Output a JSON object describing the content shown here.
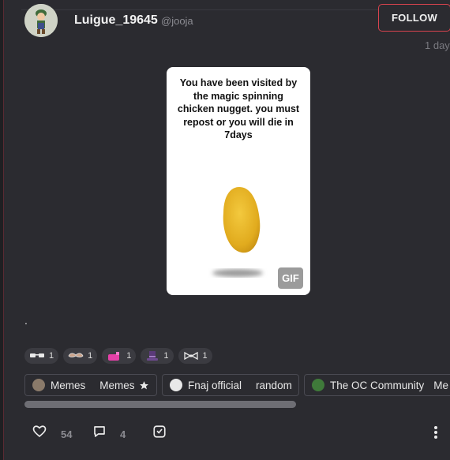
{
  "post": {
    "username": "Luigue_19645",
    "handle": "@jooja",
    "follow_label": "FOLLOW",
    "time": "1 day",
    "body": "."
  },
  "gif": {
    "caption": "You have been visited by the magic spinning chicken nugget. you must repost or you will die in 7days",
    "badge": "GIF"
  },
  "reactions": [
    {
      "icon": "glasses-icon",
      "count": "1"
    },
    {
      "icon": "mustache-icon",
      "count": "1"
    },
    {
      "icon": "pink-potion-icon",
      "count": "1"
    },
    {
      "icon": "top-hat-icon",
      "count": "1"
    },
    {
      "icon": "bowtie-icon",
      "count": "1"
    }
  ],
  "tags": [
    {
      "label": "Memes",
      "label2": "Memes",
      "icon": "star-icon"
    },
    {
      "label": "Fnaj official",
      "label2": "random"
    },
    {
      "label": "The OC Community",
      "label2": "Me"
    }
  ],
  "actions": {
    "likes": "54",
    "comments": "4"
  },
  "colors": {
    "accent": "#d8434e",
    "background": "#2b2b30",
    "nugget": "#e8b62a"
  }
}
